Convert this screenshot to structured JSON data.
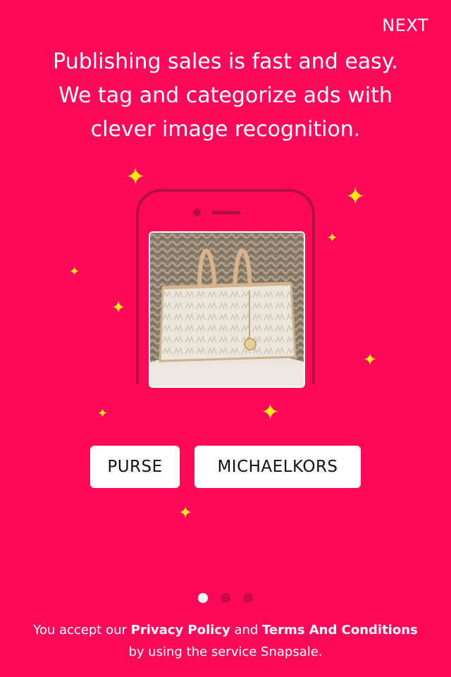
{
  "header": {
    "next_label": "NEXT"
  },
  "headline": {
    "line1": "Publishing sales is fast and easy.",
    "line2": "We tag and categorize ads with",
    "line3": "clever image recognition."
  },
  "tags": [
    "PURSE",
    "MICHAELKORS"
  ],
  "pagination": {
    "total": 3,
    "active": 1
  },
  "legal": {
    "prefix": "You accept our ",
    "privacy_link": "Privacy Policy",
    "and": " and ",
    "terms_link": "Terms And Conditions",
    "line2": "by using the service Snapsale."
  },
  "colors": {
    "background": "#FF0A5A",
    "sparkle": "#FFE81A",
    "phone_outline": "#B3103F"
  },
  "icons": {
    "sparkle": "four-point-sparkle"
  }
}
